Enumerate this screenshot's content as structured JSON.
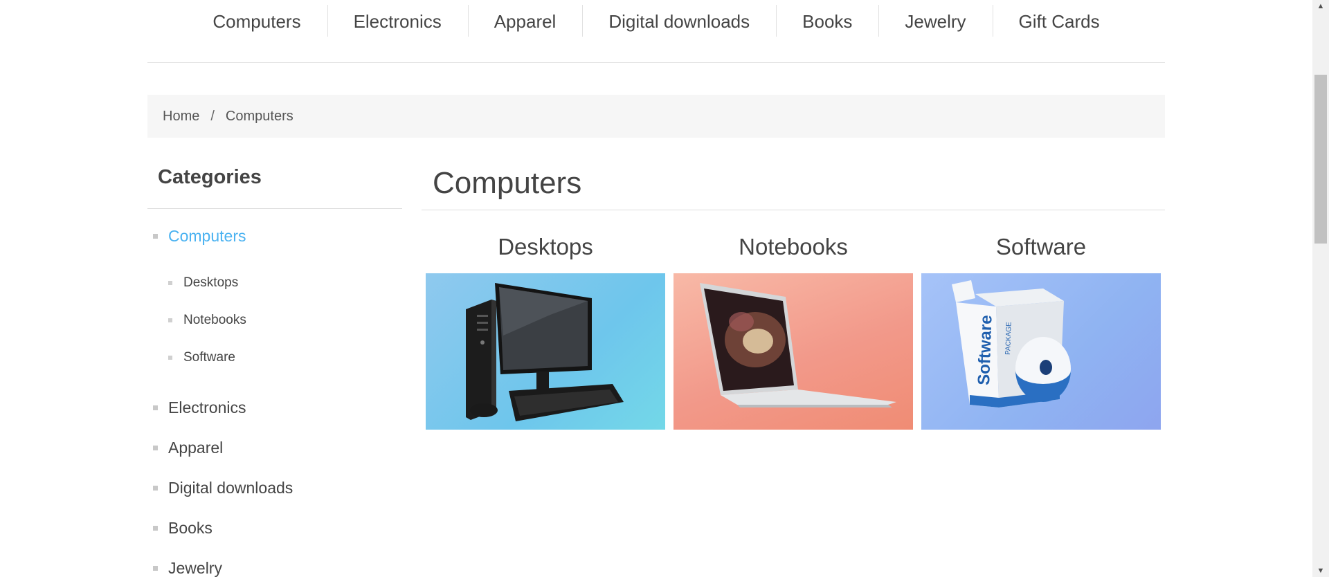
{
  "top_menu": {
    "items": [
      "Computers",
      "Electronics",
      "Apparel",
      "Digital downloads",
      "Books",
      "Jewelry",
      "Gift Cards"
    ]
  },
  "breadcrumb": {
    "home": "Home",
    "separator": "/",
    "current": "Computers"
  },
  "sidebar": {
    "title": "Categories",
    "active_category": "Computers",
    "subcategories": [
      "Desktops",
      "Notebooks",
      "Software"
    ],
    "other_categories": [
      "Electronics",
      "Apparel",
      "Digital downloads",
      "Books",
      "Jewelry"
    ]
  },
  "main": {
    "title": "Computers",
    "subcategory_cards": [
      {
        "title": "Desktops",
        "image_icon": "desktop-computer-image"
      },
      {
        "title": "Notebooks",
        "image_icon": "laptop-image"
      },
      {
        "title": "Software",
        "image_icon": "software-box-image"
      }
    ]
  },
  "colors": {
    "accent": "#4ab2f1",
    "text": "#444444",
    "breadcrumb_bg": "#f6f6f6"
  },
  "scrollbar": {
    "up_icon": "scroll-up-arrow-icon",
    "down_icon": "scroll-down-arrow-icon"
  }
}
